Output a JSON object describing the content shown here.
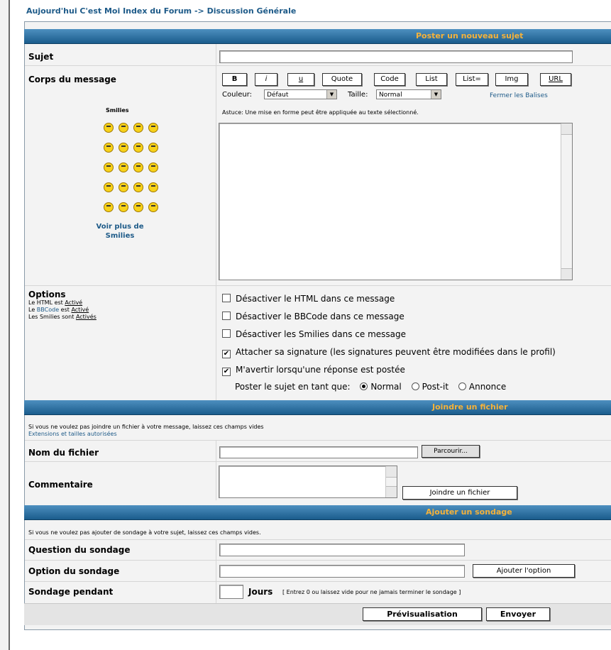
{
  "breadcrumb": {
    "forum_index": "Aujourd'hui C'est Moi Index du Forum",
    "arrow": " -> ",
    "category": "Discussion Générale"
  },
  "post_section": {
    "header": "Poster un nouveau sujet",
    "subject_label": "Sujet",
    "body_label": "Corps du message",
    "smilies_title": "Smilies",
    "more_smilies": [
      "Voir plus de",
      "Smilies"
    ],
    "bbcode_buttons": [
      "B",
      "i",
      "u",
      "Quote",
      "Code",
      "List",
      "List=",
      "Img",
      "URL"
    ],
    "color_label": "Couleur:",
    "color_value": "Défaut",
    "size_label": "Taille:",
    "size_value": "Normal",
    "close_tags": "Fermer les Balises",
    "tip": "Astuce: Une mise en forme peut être appliquée au texte sélectionné."
  },
  "options": {
    "title": "Options",
    "html_status": {
      "text": "Le HTML est",
      "link": "Activé"
    },
    "bbcode_status": {
      "prefix": "Le",
      "bbcode": "BBCode",
      "text": "est",
      "link": "Activé"
    },
    "smilies_status": {
      "text": "Les Smilies sont",
      "link": "Activés"
    },
    "checkboxes": [
      {
        "label": "Désactiver le HTML dans ce message",
        "checked": false
      },
      {
        "label": "Désactiver le BBCode dans ce message",
        "checked": false
      },
      {
        "label": "Désactiver les Smilies dans ce message",
        "checked": false
      },
      {
        "label": "Attacher sa signature (les signatures peuvent être modifiées dans le profil)",
        "checked": true
      },
      {
        "label": "M'avertir lorsqu'une réponse est postée",
        "checked": true
      }
    ],
    "post_type_label": "Poster le sujet en tant que:",
    "post_types": [
      {
        "label": "Normal",
        "selected": true
      },
      {
        "label": "Post-it",
        "selected": false
      },
      {
        "label": "Annonce",
        "selected": false
      }
    ]
  },
  "attach_section": {
    "header": "Joindre un fichier",
    "note": "Si vous ne voulez pas joindre un fichier à votre message, laissez ces champs vides",
    "extensions_link": "Extensions et tailles autorisées",
    "filename_label": "Nom du fichier",
    "browse_button": "Parcourir...",
    "comment_label": "Commentaire",
    "attach_button": "Joindre un fichier"
  },
  "poll_section": {
    "header": "Ajouter un sondage",
    "note": "Si vous ne voulez pas ajouter de sondage à votre sujet, laissez ces champs vides.",
    "question_label": "Question du sondage",
    "option_label": "Option du sondage",
    "add_option_button": "Ajouter l'option",
    "duration_label": "Sondage pendant",
    "days_label": "Jours",
    "duration_hint": "[ Entrez 0 ou laissez vide pour ne jamais terminer le sondage ]"
  },
  "footer": {
    "preview_button": "Prévisualisation",
    "submit_button": "Envoyer"
  },
  "colors": {
    "header_top": "#4d8fbf",
    "header_bottom": "#1a5c8c",
    "header_text": "#f5b23a",
    "link": "#1d5a88",
    "panel_bg": "#f3f3f3"
  }
}
